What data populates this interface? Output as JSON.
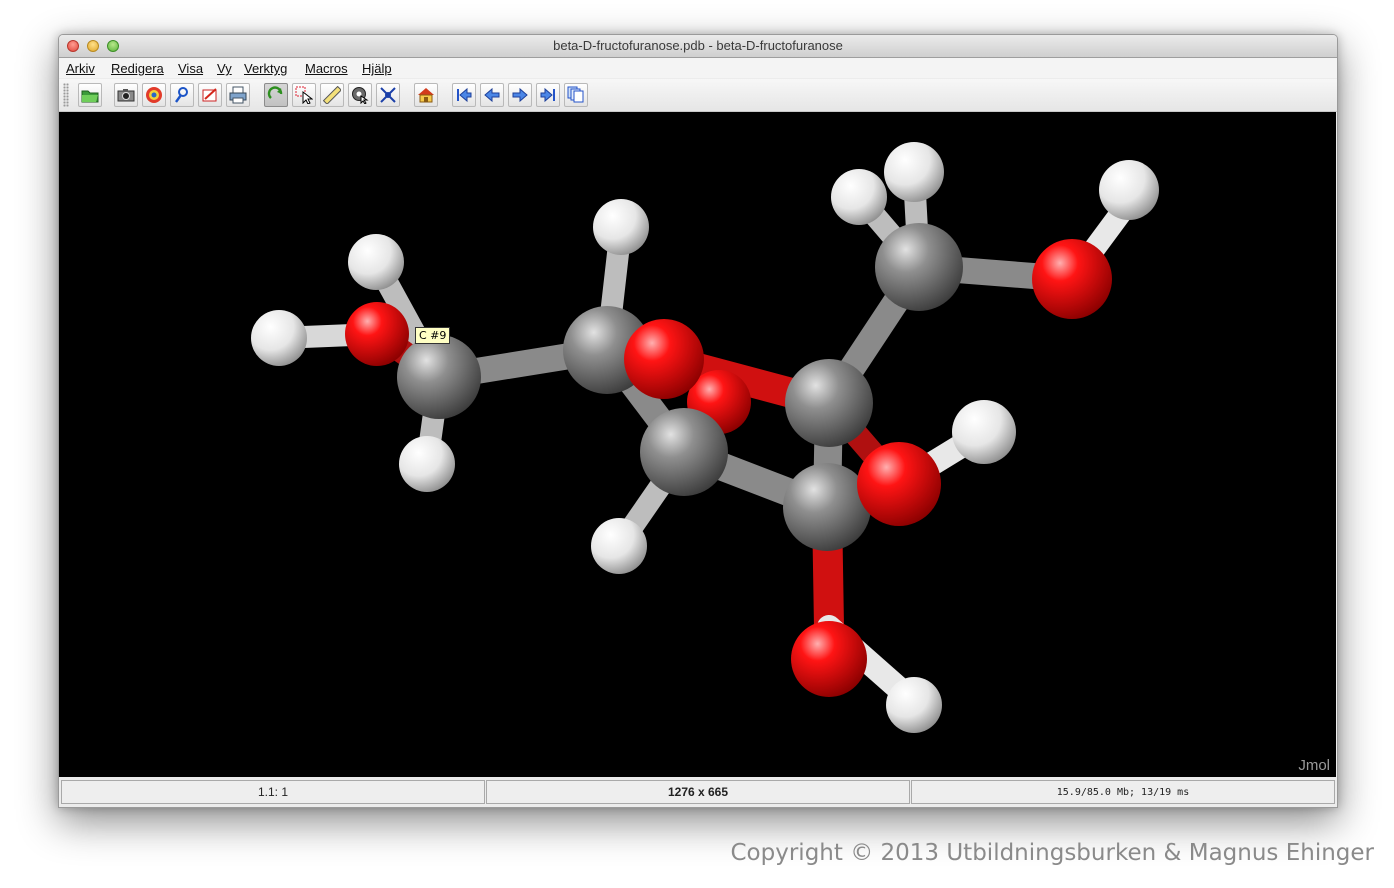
{
  "window": {
    "title": "beta-D-fructofuranose.pdb - beta-D-fructofuranose"
  },
  "menu": {
    "items": [
      {
        "label": "Arkiv"
      },
      {
        "label": "Redigera"
      },
      {
        "label": "Visa"
      },
      {
        "label": "Vy"
      },
      {
        "label": "Verktyg"
      },
      {
        "label": "Macros"
      },
      {
        "label": "Hjälp"
      }
    ]
  },
  "toolbar": {
    "buttons": [
      {
        "icon": "open-folder-icon"
      },
      {
        "icon": "camera-icon"
      },
      {
        "icon": "script-globe-icon"
      },
      {
        "icon": "magnifier-icon"
      },
      {
        "icon": "edit-pencil-icon"
      },
      {
        "icon": "printer-icon"
      },
      {
        "icon": "rotate-icon",
        "pressed": true
      },
      {
        "icon": "select-pointer-icon"
      },
      {
        "icon": "ruler-icon"
      },
      {
        "icon": "pick-center-icon"
      },
      {
        "icon": "crosshair-icon"
      },
      {
        "icon": "home-icon"
      },
      {
        "icon": "first-frame-icon"
      },
      {
        "icon": "previous-frame-icon"
      },
      {
        "icon": "next-frame-icon"
      },
      {
        "icon": "last-frame-icon"
      },
      {
        "icon": "all-frames-icon"
      }
    ]
  },
  "viewer": {
    "hover_label": "C #9",
    "watermark": "Jmol",
    "colors": {
      "background": "#000000",
      "carbon": "#8c8c8c",
      "oxygen": "#ff0d0d",
      "hydrogen": "#ffffff"
    }
  },
  "status": {
    "frame": "1.1: 1",
    "size": "1276 x 665",
    "perf": "15.9/85.0 Mb;  13/19 ms"
  },
  "footer": {
    "copyright": "Copyright © 2013 Utbildningsburken & Magnus Ehinger"
  }
}
